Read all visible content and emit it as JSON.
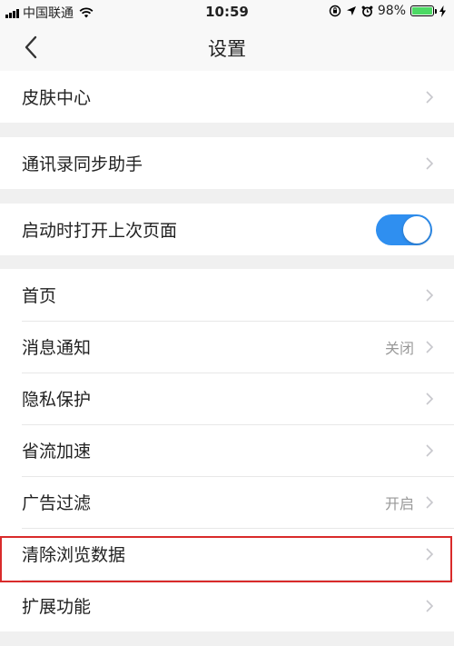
{
  "status_bar": {
    "carrier": "中国联通",
    "time": "10:59",
    "battery": "98%",
    "battery_level": 0.98
  },
  "nav": {
    "title": "设置"
  },
  "groups": {
    "skin": {
      "label": "皮肤中心"
    },
    "contacts": {
      "label": "通讯录同步助手"
    },
    "startup": {
      "label": "启动时打开上次页面",
      "enabled": true
    },
    "main": [
      {
        "label": "首页",
        "value": ""
      },
      {
        "label": "消息通知",
        "value": "关闭"
      },
      {
        "label": "隐私保护",
        "value": ""
      },
      {
        "label": "省流加速",
        "value": ""
      },
      {
        "label": "广告过滤",
        "value": "开启"
      },
      {
        "label": "清除浏览数据",
        "value": "",
        "highlighted": true
      },
      {
        "label": "扩展功能",
        "value": ""
      }
    ]
  },
  "colors": {
    "toggle_on": "#2f8ff0",
    "highlight": "#d92b2b",
    "battery": "#4cd964"
  }
}
